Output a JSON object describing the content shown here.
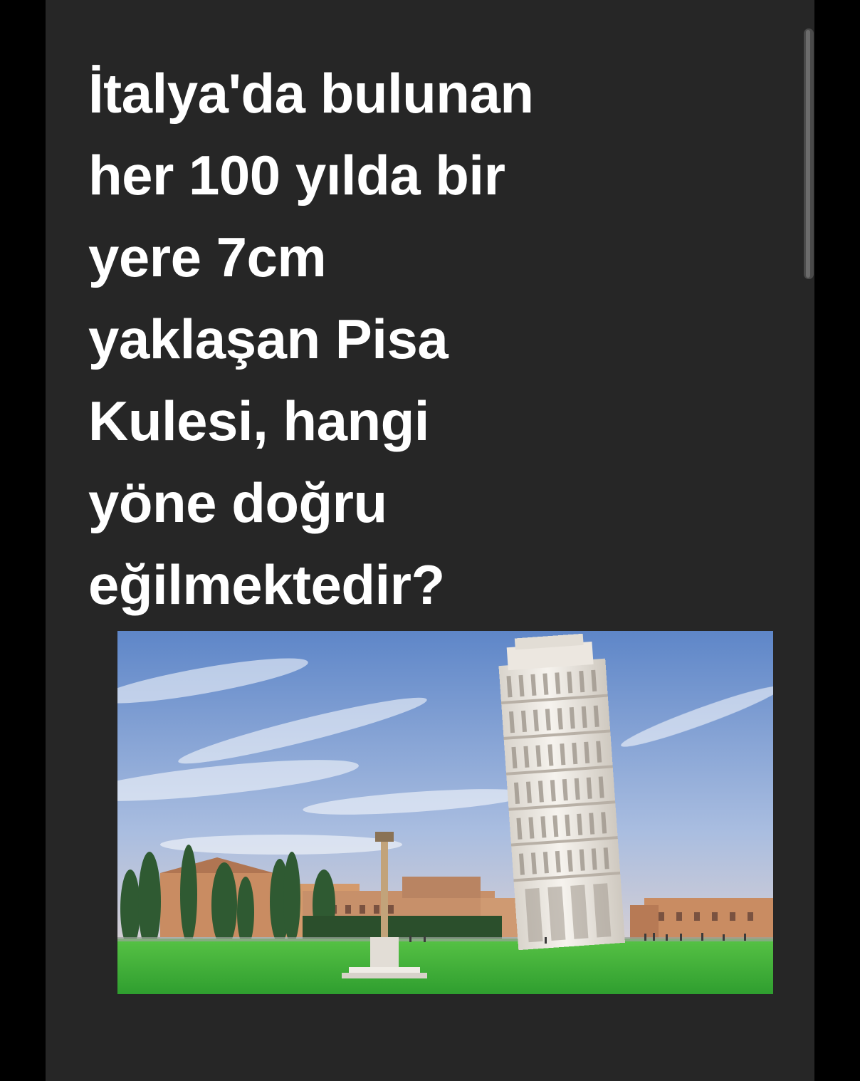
{
  "post": {
    "headline_lines": [
      "İtalya'da bulunan",
      "her 100 yılda bir",
      "yere 7cm",
      "yaklaşan Pisa",
      "Kulesi, hangi",
      "yöne doğru",
      "eğilmektedir?"
    ]
  },
  "photo": {
    "subject": "leaning-tower-of-pisa",
    "colors": {
      "sky_top": "#5e86c8",
      "sky_bottom": "#e9d7cf",
      "grass": "#3db33a",
      "tower": "#eeeae4",
      "buildings": "#c98c62",
      "trees": "#2f5a32"
    }
  },
  "colors": {
    "background": "#000000",
    "panel": "#262626",
    "text": "#ffffff"
  }
}
